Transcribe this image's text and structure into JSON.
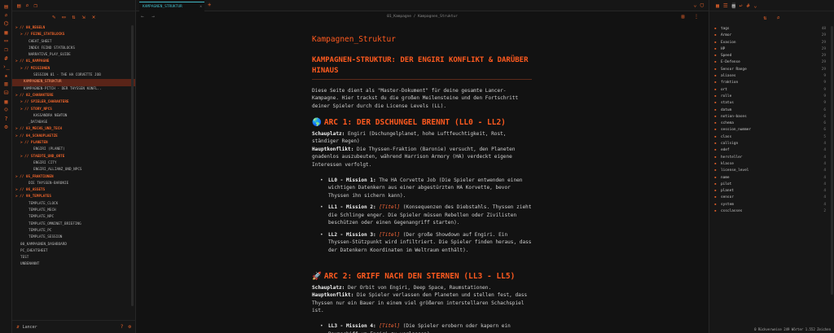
{
  "ribbon": {
    "icons": [
      "files-icon",
      "search-icon",
      "graph-icon",
      "calendar-icon",
      "canvas-icon",
      "template-icon",
      "tag-icon",
      "terminal-icon",
      "bookmark-icon",
      "kanban-icon",
      "database-icon",
      "table-icon",
      "person-icon",
      "help-icon",
      "settings-icon"
    ]
  },
  "left_panel": {
    "tabs": [
      "files-tab-icon",
      "search-tab-icon",
      "bookmarks-tab-icon"
    ],
    "toolbar": [
      "new-note-icon",
      "new-folder-icon",
      "sort-icon",
      "collapse-icon",
      "close-icon"
    ],
    "tree": [
      {
        "label": "> // 00_REGELN",
        "type": "folder",
        "indent": 4
      },
      {
        "label": "> // FEINE_STATBLOCKS",
        "type": "folder",
        "indent": 10
      },
      {
        "label": "CHEAT_SHEET",
        "type": "file",
        "indent": 20
      },
      {
        "label": "INDEX FEIND STATBLOCKS",
        "type": "file",
        "indent": 20
      },
      {
        "label": "NARRATIVE_PLAY_GUIDE",
        "type": "file",
        "indent": 20
      },
      {
        "label": "> // 01_KAMPAGNE",
        "type": "folder",
        "indent": 4
      },
      {
        "label": "> // MISSIONEN",
        "type": "folder",
        "indent": 10
      },
      {
        "label": "SESSION 01 - THE HA CORVETTE JOB",
        "type": "file",
        "indent": 26
      },
      {
        "label": "KAMPAGNEN_STRUKTUR",
        "type": "file",
        "indent": 14,
        "active": true
      },
      {
        "label": "KAMPAGNEN-PITCH - DER THYSSEN KONFL..",
        "type": "file",
        "indent": 14
      },
      {
        "label": "> // 02_CHARAKTERE",
        "type": "folder",
        "indent": 4
      },
      {
        "label": "> // SPIELER_CHARAKTERE",
        "type": "folder",
        "indent": 10
      },
      {
        "label": "> // STORY_NPCS",
        "type": "folder",
        "indent": 10
      },
      {
        "label": "KASSANDRA NEWTON",
        "type": "file",
        "indent": 26
      },
      {
        "label": "_DATABASE",
        "type": "file",
        "indent": 20
      },
      {
        "label": "> // 03_MECHS_UND_TECH",
        "type": "folder",
        "indent": 4
      },
      {
        "label": "> // 04_SCHAUPLAETZE",
        "type": "folder",
        "indent": 4
      },
      {
        "label": "> // PLANETEN",
        "type": "folder",
        "indent": 10
      },
      {
        "label": "ENGIRI (PLANET)",
        "type": "file",
        "indent": 26
      },
      {
        "label": "> // STAEDTE_UND_ORTE",
        "type": "folder",
        "indent": 10
      },
      {
        "label": "ENGIRI CITY",
        "type": "file",
        "indent": 26
      },
      {
        "label": "ENGIRI_ALLIANZ_UND_NPCS",
        "type": "file",
        "indent": 26
      },
      {
        "label": "> // 05_FRAKTIONEN",
        "type": "folder",
        "indent": 4
      },
      {
        "label": "DIE THYSSEN-BARONIE",
        "type": "file",
        "indent": 20
      },
      {
        "label": "> // 06_ASSETS",
        "type": "folder",
        "indent": 4
      },
      {
        "label": "> // 99_TEMPLATES",
        "type": "folder",
        "indent": 4
      },
      {
        "label": "TEMPLATE_CLOCK",
        "type": "file",
        "indent": 20
      },
      {
        "label": "TEMPLATE_MECH",
        "type": "file",
        "indent": 20
      },
      {
        "label": "TEMPLATE_NPC",
        "type": "file",
        "indent": 20
      },
      {
        "label": "TEMPLATE_OMNINET_BRIEFING",
        "type": "file",
        "indent": 20
      },
      {
        "label": "TEMPLATE_PC",
        "type": "file",
        "indent": 20
      },
      {
        "label": "TEMPLATE_SESSION",
        "type": "file",
        "indent": 20
      },
      {
        "label": "00_KAMPAGNEN_DASHBOARD",
        "type": "file",
        "indent": 10
      },
      {
        "label": "PC_CHEATSHEET",
        "type": "file",
        "indent": 10
      },
      {
        "label": "TEST",
        "type": "file",
        "indent": 10
      },
      {
        "label": "UNBENANNT",
        "type": "file",
        "indent": 10
      }
    ],
    "footer_label": "Lancer"
  },
  "tabbar": {
    "active_tab": "KAMPAGNEN_STRUKTUR"
  },
  "view": {
    "breadcrumb": "01_Kampagne / Kampagnen_Struktur"
  },
  "document": {
    "page_title": "Kampagnen_Struktur",
    "h1": "KAMPAGNEN-STRUKTUR: DER ENGIRI KONFLIKT & DARÜBER HINAUS",
    "intro": "Diese Seite dient als \"Master-Dokument\" für deine gesamte Lancer-Kampagne. Hier trackst du die großen Meilensteine und den Fortschritt deiner Spieler durch die License Levels (LL).",
    "arc1": {
      "emoji": "🌎",
      "title": "ARC 1: DER DSCHUNGEL BRENNT (LL0 - LL2)",
      "setting_label": "Schauplatz:",
      "setting": "Engiri (Dschungelplanet, hohe Luftfeuchtigkeit, Rost, ständiger Regen)",
      "conflict_label": "Hauptkonflikt:",
      "conflict": "Die Thyssen-Fraktion (Baronie) versucht, den Planeten gnadenlos auszubeuten, während Harrison Armory (HA) verdeckt eigene Interessen verfolgt.",
      "items": [
        {
          "lead": "LL0 - Mission 1:",
          "tag": "",
          "text": "The HA Corvette Job (Die Spieler entwenden einen wichtigen Datenkern aus einer abgestürzten HA Korvette, bevor Thyssen ihn sichern kann)."
        },
        {
          "lead": "LL1 - Mission 2:",
          "tag": "[Titel]",
          "text": "(Konsequenzen des Diebstahls. Thyssen zieht die Schlinge enger. Die Spieler müssen Rebellen oder Zivilisten beschützen oder einen Gegenangriff starten)."
        },
        {
          "lead": "LL2 - Mission 3:",
          "tag": "[Titel]",
          "text": "(Der große Showdown auf Engiri. Ein Thyssen-Stützpunkt wird infiltriert. Die Spieler finden heraus, dass der Datenkern Koordinaten im Weltraum enthält)."
        }
      ]
    },
    "arc2": {
      "emoji": "🚀",
      "title": "ARC 2: GRIFF NACH DEN STERNEN (LL3 - LL5)",
      "setting_label": "Schauplatz:",
      "setting": "Der Orbit von Engiri, Deep Space, Raumstationen.",
      "conflict_label": "Hauptkonflikt:",
      "conflict": "Die Spieler verlassen den Planeten und stellen fest, dass Thyssen nur ein Bauer in einem viel größeren interstellaren Schachspiel ist.",
      "items": [
        {
          "lead": "LL3 - Mission 4:",
          "tag": "[Titel]",
          "text": "(Die Spieler erobern oder kapern ein Raumschiff um Engiri zu verlassen)"
        }
      ]
    }
  },
  "right_panel": {
    "tabs": [
      "calendar-tab-icon",
      "outline-tab-icon",
      "properties-tab-icon",
      "backlinks-tab-icon",
      "tags-tab-icon"
    ],
    "properties": [
      {
        "name": "tags",
        "count": "48"
      },
      {
        "name": "Armor",
        "count": "29"
      },
      {
        "name": "Evasion",
        "count": "29"
      },
      {
        "name": "HP",
        "count": "29"
      },
      {
        "name": "Speed",
        "count": "29"
      },
      {
        "name": "E-Defense",
        "count": "29"
      },
      {
        "name": "Sensor Range",
        "count": "29"
      },
      {
        "name": "aliases",
        "count": "9"
      },
      {
        "name": "fraktion",
        "count": "9"
      },
      {
        "name": "ort",
        "count": "9"
      },
      {
        "name": "rolle",
        "count": "9"
      },
      {
        "name": "status",
        "count": "9"
      },
      {
        "name": "datum",
        "count": "6"
      },
      {
        "name": "notion-bases",
        "count": "6"
      },
      {
        "name": "schema",
        "count": "6"
      },
      {
        "name": "session_nummer",
        "count": "6"
      },
      {
        "name": "class",
        "count": "5"
      },
      {
        "name": "callsign",
        "count": "4"
      },
      {
        "name": "edef",
        "count": "4"
      },
      {
        "name": "hersteller",
        "count": "4"
      },
      {
        "name": "klasse",
        "count": "4"
      },
      {
        "name": "license_level",
        "count": "4"
      },
      {
        "name": "name",
        "count": "4"
      },
      {
        "name": "pilot",
        "count": "4"
      },
      {
        "name": "planet",
        "count": "4"
      },
      {
        "name": "sensor",
        "count": "4"
      },
      {
        "name": "system",
        "count": "4"
      },
      {
        "name": "cssclasses",
        "count": "2"
      }
    ],
    "status": "0 Rückverweise   249 Wörter 1.552 Zeichen"
  }
}
